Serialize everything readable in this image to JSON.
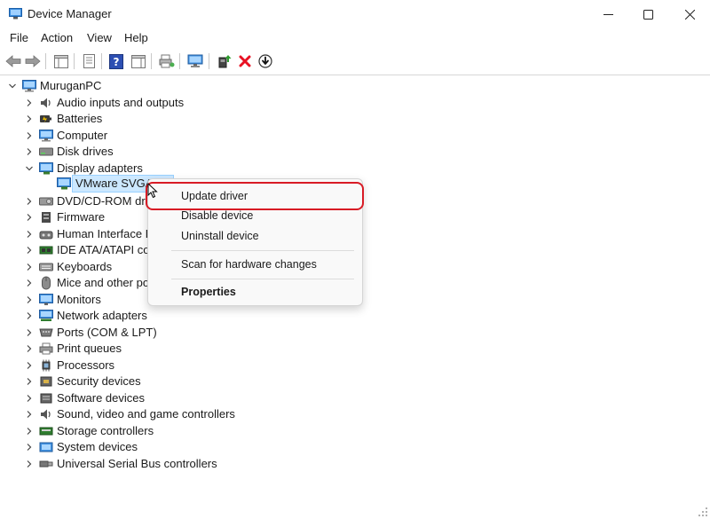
{
  "window": {
    "title": "Device Manager"
  },
  "menu": [
    "File",
    "Action",
    "View",
    "Help"
  ],
  "tree": {
    "root": "MuruganPC",
    "categories": [
      {
        "label": "Audio inputs and outputs",
        "icon": "speaker-icon"
      },
      {
        "label": "Batteries",
        "icon": "battery-icon"
      },
      {
        "label": "Computer",
        "icon": "computer-icon"
      },
      {
        "label": "Disk drives",
        "icon": "disk-drive-icon"
      },
      {
        "label": "Display adapters",
        "icon": "display-adapter-icon",
        "expanded": true
      },
      {
        "label": "DVD/CD-ROM drives",
        "icon": "dvd-drive-icon"
      },
      {
        "label": "Firmware",
        "icon": "firmware-icon"
      },
      {
        "label": "Human Interface Devices",
        "icon": "hid-icon"
      },
      {
        "label": "IDE ATA/ATAPI controllers",
        "icon": "ide-controller-icon"
      },
      {
        "label": "Keyboards",
        "icon": "keyboard-icon"
      },
      {
        "label": "Mice and other pointing devices",
        "icon": "mouse-icon"
      },
      {
        "label": "Monitors",
        "icon": "monitor-icon"
      },
      {
        "label": "Network adapters",
        "icon": "network-adapter-icon"
      },
      {
        "label": "Ports (COM & LPT)",
        "icon": "port-icon"
      },
      {
        "label": "Print queues",
        "icon": "printer-icon"
      },
      {
        "label": "Processors",
        "icon": "processor-icon"
      },
      {
        "label": "Security devices",
        "icon": "security-device-icon"
      },
      {
        "label": "Software devices",
        "icon": "software-device-icon"
      },
      {
        "label": "Sound, video and game controllers",
        "icon": "sound-controller-icon"
      },
      {
        "label": "Storage controllers",
        "icon": "storage-controller-icon"
      },
      {
        "label": "System devices",
        "icon": "system-device-icon"
      },
      {
        "label": "Universal Serial Bus controllers",
        "icon": "usb-icon"
      }
    ],
    "child": "VMware SVGA 3D"
  },
  "context_menu": {
    "update_driver": "Update driver",
    "disable_device": "Disable device",
    "uninstall_device": "Uninstall device",
    "scan": "Scan for hardware changes",
    "properties": "Properties"
  },
  "colors": {
    "selection": "#cce8ff",
    "highlight_outline": "#d81b25",
    "uninstall_red": "#e81123"
  }
}
